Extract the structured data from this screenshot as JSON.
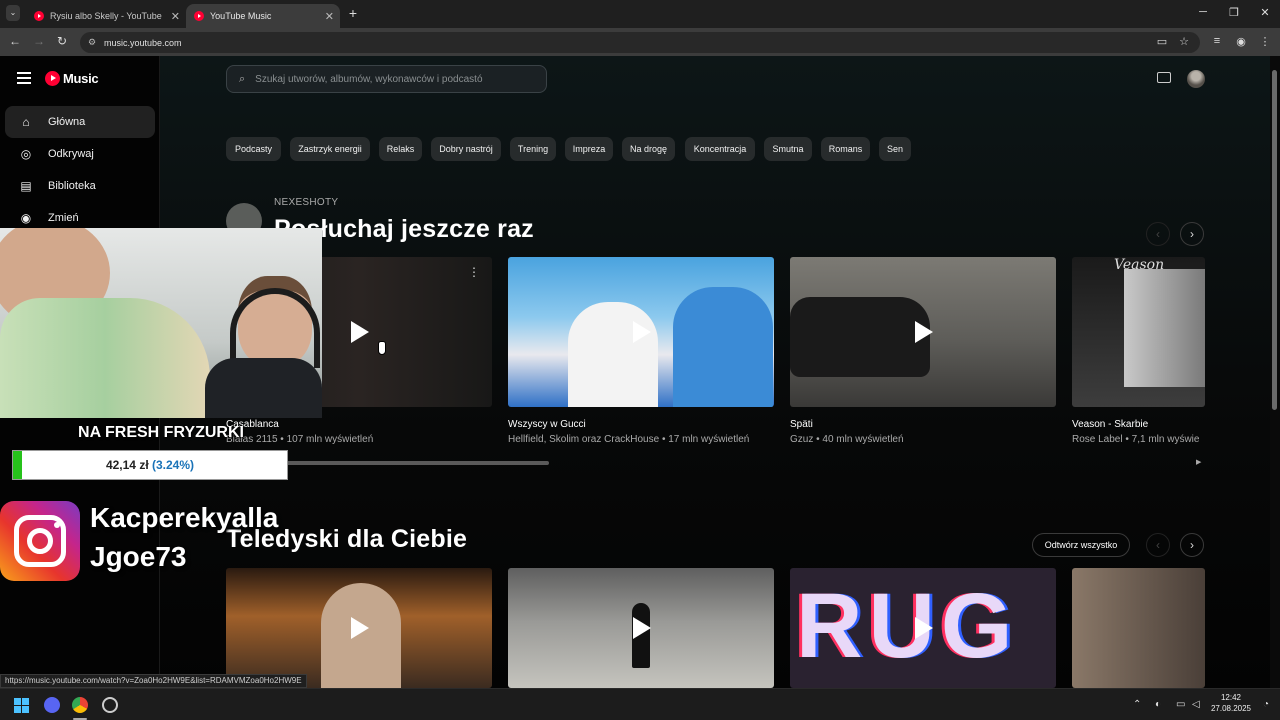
{
  "browser": {
    "tabs": [
      {
        "title": "Rysiu albo Skelly - YouTube",
        "active": false
      },
      {
        "title": "YouTube Music",
        "active": true
      }
    ],
    "new_tab": "+",
    "url": "music.youtube.com",
    "window_controls": {
      "minimize": "─",
      "restore": "❐",
      "close": "✕"
    }
  },
  "app": {
    "logo_text": "Music",
    "menu_icon": "hamburger-icon",
    "sidebar": {
      "items": [
        {
          "label": "Główna",
          "icon": "home-icon",
          "active": true
        },
        {
          "label": "Odkrywaj",
          "icon": "compass-icon",
          "active": false
        },
        {
          "label": "Biblioteka",
          "icon": "library-icon",
          "active": false
        },
        {
          "label": "Zmień",
          "icon": "upgrade-icon",
          "active": false
        }
      ]
    },
    "search": {
      "placeholder": "Szukaj utworów, albumów, wykonawców i podcastó"
    },
    "chips": [
      "Podcasty",
      "Zastrzyk energii",
      "Relaks",
      "Dobry nastrój",
      "Trening",
      "Impreza",
      "Na drogę",
      "Koncentracja",
      "Smutna",
      "Romans",
      "Sen"
    ],
    "shelf1": {
      "kicker": "NEXESHOTY",
      "title": "Posłuchaj jeszcze raz",
      "cards": [
        {
          "title": "Casablanca",
          "subtitle": "Białas 2115 • 107 mln wyświetleń"
        },
        {
          "title": "Wszyscy w Gucci",
          "subtitle": "Hellfield, Skolim oraz CrackHouse • 17 mln wyświetleń"
        },
        {
          "title": "Späti",
          "subtitle": "Gzuz • 40 mln wyświetleń"
        },
        {
          "title": "Veason - Skarbie",
          "subtitle": "Rose Label • 7,1 mln wyświe"
        }
      ],
      "thumb_text_card4": "Veason"
    },
    "shelf2": {
      "title": "Teledyski dla Ciebie",
      "play_all": "Odtwórz wszystko",
      "thumb_text_card3": "RUG"
    }
  },
  "overlay": {
    "goal_label": "NA FRESH FRYZURKI",
    "goal_amount": "42,14 zł",
    "goal_percent": "(3.24%)",
    "goal_progress": 0.0324,
    "instagram_handles": [
      "Kacperekyalla",
      "Jgoe73"
    ]
  },
  "status_url": "https://music.youtube.com/watch?v=Zoa0Ho2HW9E&list=RDAMVMZoa0Ho2HW9E",
  "taskbar": {
    "time": "12:42",
    "date": "27.08.2025"
  },
  "colors": {
    "youtube_red": "#ff0033",
    "goal_green": "#26c21b",
    "percent_blue": "#1a73b8"
  }
}
